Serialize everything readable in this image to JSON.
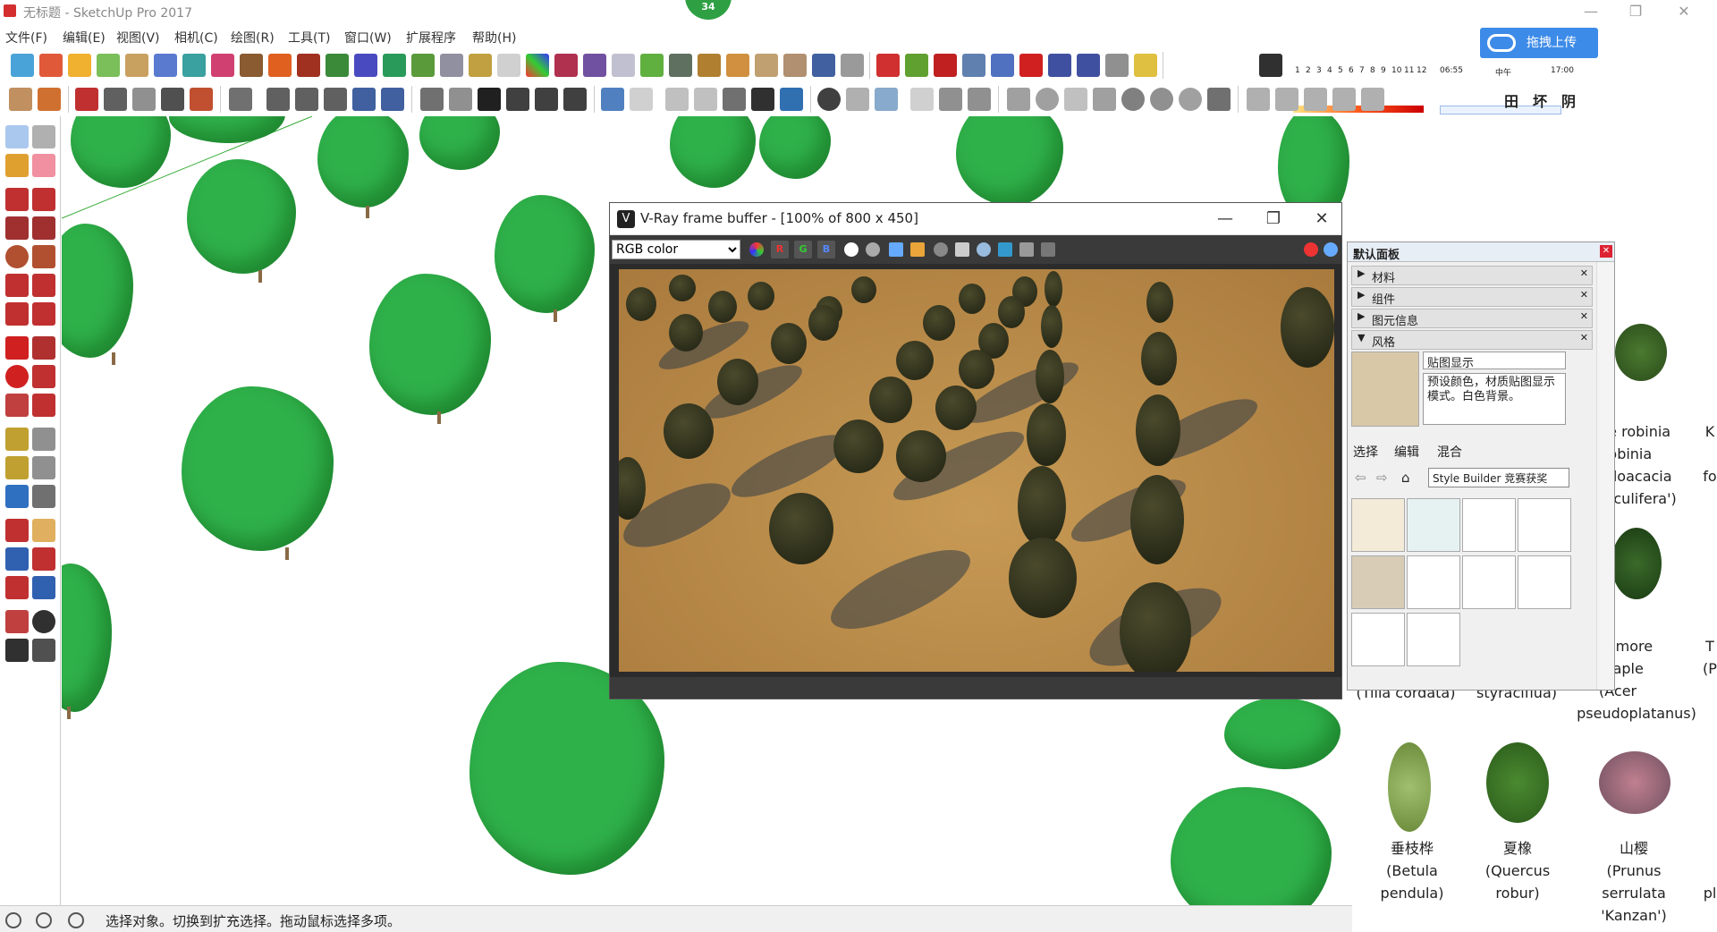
{
  "window": {
    "title": "无标题 - SketchUp Pro 2017",
    "minimize": "—",
    "maximize": "❐",
    "close": "✕",
    "badge": "34"
  },
  "upload": {
    "label": "拖拽上传"
  },
  "menu": [
    "文件(F)",
    "编辑(E)",
    "视图(V)",
    "相机(C)",
    "绘图(R)",
    "工具(T)",
    "窗口(W)",
    "扩展程序",
    "帮助(H)"
  ],
  "shadow": {
    "months": [
      "1",
      "2",
      "3",
      "4",
      "5",
      "6",
      "7",
      "8",
      "9",
      "10",
      "11",
      "12"
    ],
    "time_start": "06:55",
    "time_mid": "中午",
    "time_end": "17:00",
    "icons": [
      "田",
      "坏",
      "阴"
    ]
  },
  "vray": {
    "title": "V-Ray frame buffer - [100% of 800 x 450]",
    "channel": "RGB color",
    "channels": [
      "R",
      "G",
      "B"
    ]
  },
  "panel": {
    "title": "默认面板",
    "sections": [
      "材料",
      "组件",
      "图元信息",
      "风格"
    ],
    "style_name": "贴图显示",
    "style_desc": "预设颜色，材质贴图显示模式。白色背景。",
    "tabs": [
      "选择",
      "编辑",
      "混合"
    ],
    "collection": "Style Builder 竞赛获奖"
  },
  "components": {
    "partial_top": [
      "(Tilia cordata)",
      "styraciflua)"
    ],
    "row1_col3": [
      "pe robinia",
      "Robinia",
      "udoacacia",
      "raculifera')"
    ],
    "row1_col4": [
      "K",
      "fo"
    ],
    "row2_col3": [
      "camore",
      "maple",
      "(Acer",
      "pseudoplatanus)"
    ],
    "row2_col4": [
      "T",
      "(P"
    ],
    "row3": [
      {
        "cn": "垂枝桦",
        "lat1": "(Betula",
        "lat2": "pendula)"
      },
      {
        "cn": "夏橡",
        "lat1": "(Quercus",
        "lat2": "robur)"
      },
      {
        "cn": "山樱",
        "lat1": "(Prunus",
        "lat2": "serrulata",
        "lat3": "'Kanzan')"
      }
    ],
    "row3_col4": "pl"
  },
  "status": {
    "message": "选择对象。切换到扩充选择。拖动鼠标选择多项。"
  }
}
